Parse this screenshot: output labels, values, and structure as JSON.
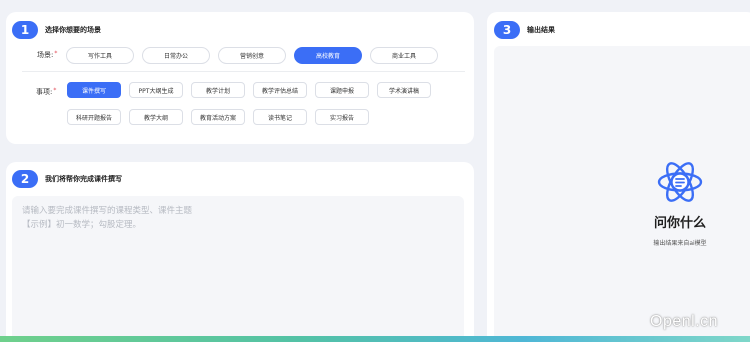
{
  "step1": {
    "number": "1",
    "title": "选择你想要的场景",
    "scene_label": "场景:",
    "scenes": [
      "写作工具",
      "日常办公",
      "营销创意",
      "高校教育",
      "商业工具"
    ],
    "active_scene": "高校教育",
    "task_label": "事项:",
    "tasks_row1": [
      "课件撰写",
      "PPT大纲生成",
      "教学计划",
      "教学评估总结",
      "课题申报",
      "学术演讲稿"
    ],
    "tasks_row2": [
      "科研开题报告",
      "教学大纲",
      "教育活动方案",
      "读书笔记",
      "实习报告"
    ],
    "active_task": "课件撰写"
  },
  "step2": {
    "number": "2",
    "title": "我们将帮你完成课件撰写",
    "placeholder_line1": "请输入要完成课件撰写的课程类型、课件主题",
    "placeholder_line2": "【示例】初一数学；勾股定理。"
  },
  "step3": {
    "number": "3",
    "title": "输出结果",
    "output_title": "问你什么",
    "output_subtitle": "输出结果来自ai模型"
  },
  "watermark": "Openl.cn",
  "colors": {
    "accent": "#3b6ef6",
    "background": "#f0f2f7",
    "placeholder": "#b6bac2",
    "required_mark": "#e34d59"
  }
}
